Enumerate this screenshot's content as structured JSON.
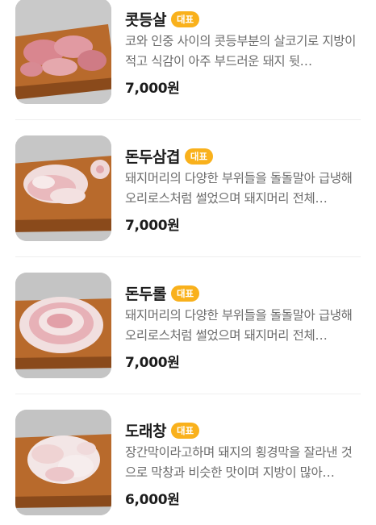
{
  "menu": {
    "items": [
      {
        "name": "콧등살",
        "badge": "대표",
        "description": "코와 인중 사이의 콧등부분의 살코기로 지방이 적고 식감이 아주 부드러운 돼지 뒷…",
        "price": "7,000원",
        "image_icon": "sliced-pork-meat-on-board"
      },
      {
        "name": "돈두삼겹",
        "badge": "대표",
        "description": "돼지머리의 다양한 부위들을 돌돌말아 급냉해 오리로스처럼 썰었으며 돼지머리 전체…",
        "price": "7,000원",
        "image_icon": "rolled-pork-slices-on-board"
      },
      {
        "name": "돈두롤",
        "badge": "대표",
        "description": "돼지머리의 다양한 부위들을 돌돌말아 급냉해 오리로스처럼 썰었으며 돼지머리 전체…",
        "price": "7,000원",
        "image_icon": "pork-roll-slices-on-board"
      },
      {
        "name": "도래창",
        "badge": "대표",
        "description": "장간막이라고하며 돼지의 횡경막을 잘라낸 것으로 막창과 비슷한 맛이며 지방이 많아…",
        "price": "6,000원",
        "image_icon": "pork-intestine-on-board"
      }
    ]
  },
  "colors": {
    "badge": "#f9b11c",
    "board": "#b86a2c",
    "meat": "#e7a3a3"
  }
}
